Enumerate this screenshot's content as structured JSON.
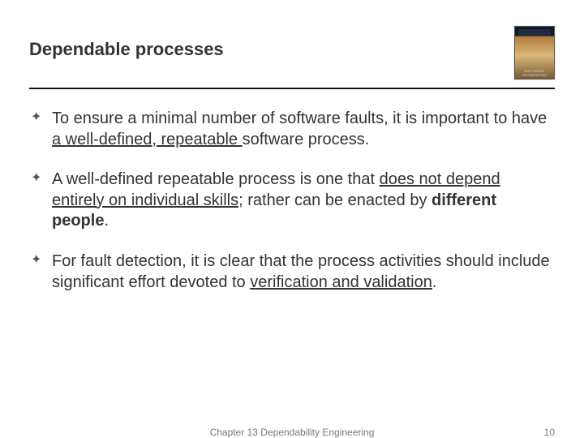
{
  "header": {
    "title": "Dependable processes",
    "book_label": "SOFTWARE ENGINEERING"
  },
  "bullets": [
    {
      "pre": "To ensure a minimal number of software faults, it is important to have ",
      "u1": "a well-defined, repeatable ",
      "post": "software process."
    },
    {
      "pre": "A well-defined repeatable process is one that ",
      "u1": "does not depend entirely on individual skills",
      "mid": "; rather can be enacted by ",
      "b1": "different people",
      "post": "."
    },
    {
      "pre": "For fault detection, it is clear that the process activities should include significant effort devoted to ",
      "u1": "verification and validation",
      "post": "."
    }
  ],
  "footer": {
    "chapter": "Chapter 13 Dependability Engineering",
    "page": "10"
  }
}
